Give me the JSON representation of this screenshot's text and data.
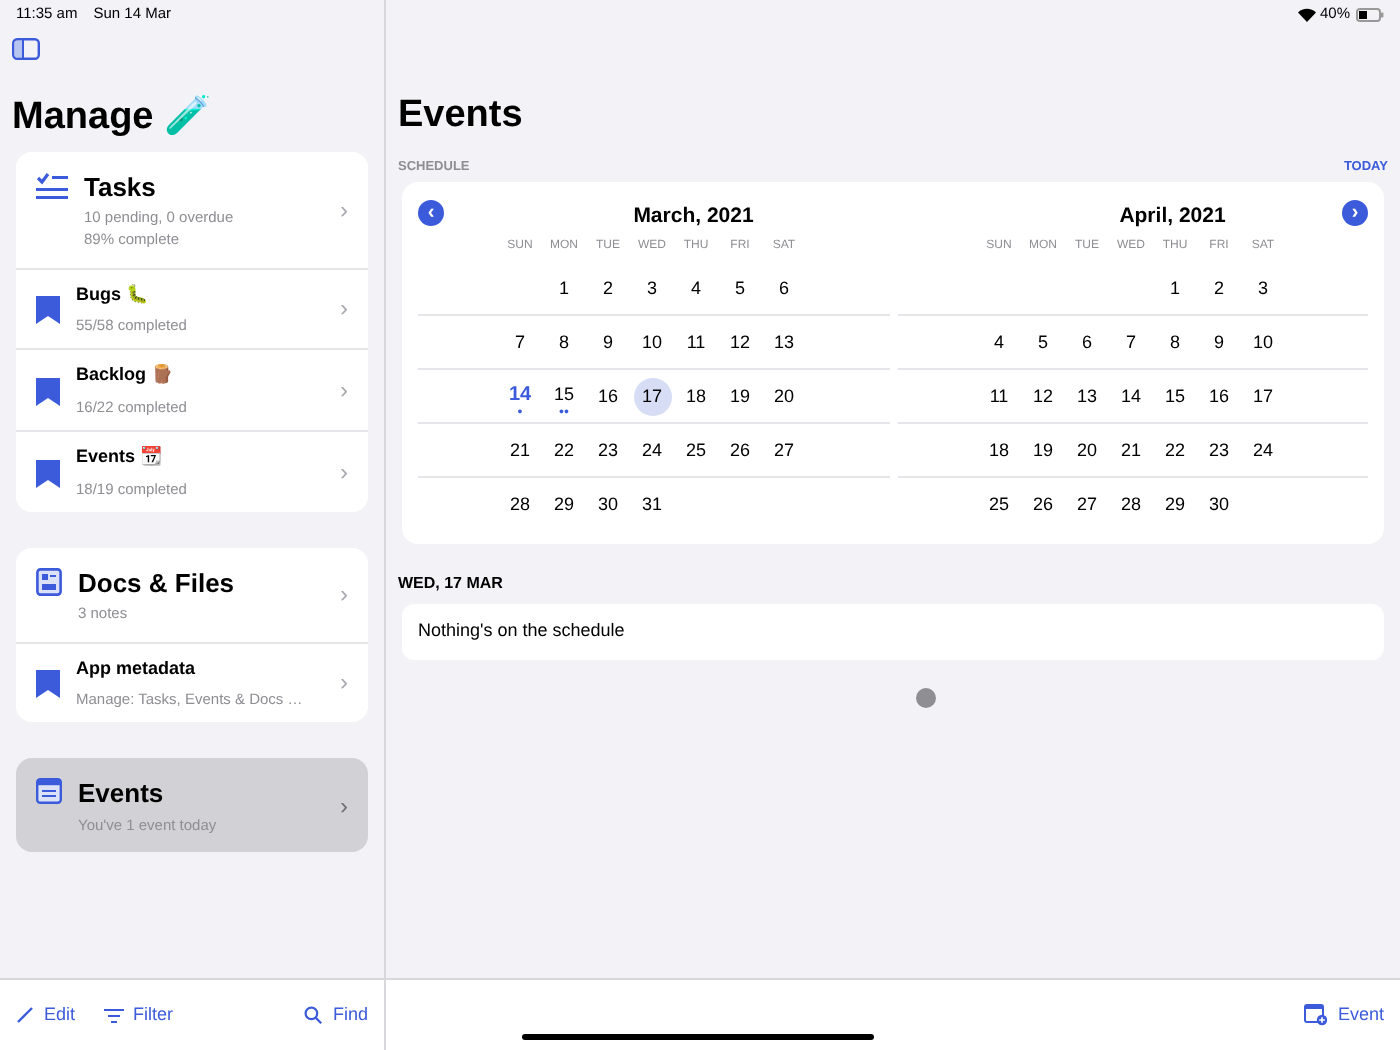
{
  "status_bar": {
    "time": "11:35 am",
    "date": "Sun 14 Mar",
    "battery": "40%"
  },
  "sidebar": {
    "title": "Manage 🧪",
    "groups": [
      {
        "items": [
          {
            "kind": "header",
            "title": "Tasks",
            "lines": [
              "10 pending, 0 overdue",
              "89% complete"
            ],
            "selected": false
          },
          {
            "kind": "list",
            "title": "Bugs 🐛",
            "lines": [
              "55/58 completed"
            ],
            "selected": false
          },
          {
            "kind": "list",
            "title": "Backlog 🪵",
            "lines": [
              "16/22 completed"
            ],
            "selected": false
          },
          {
            "kind": "list",
            "title": "Events 📆",
            "lines": [
              "18/19 completed"
            ],
            "selected": false
          }
        ]
      },
      {
        "items": [
          {
            "kind": "header",
            "title": "Docs & Files",
            "lines": [
              "3 notes"
            ],
            "selected": false
          },
          {
            "kind": "list",
            "title": "App metadata",
            "lines": [
              "Manage: Tasks, Events & Docs …"
            ],
            "selected": false
          }
        ]
      },
      {
        "items": [
          {
            "kind": "header",
            "title": "Events",
            "lines": [
              "You've 1 event today"
            ],
            "selected": true
          }
        ]
      }
    ],
    "chevron": "›",
    "toolbar": [
      {
        "label": "Edit"
      },
      {
        "label": "Filter"
      },
      {
        "label": "Find"
      }
    ]
  },
  "main": {
    "title": "Events",
    "section_label": "SCHEDULE",
    "today_link": "TODAY",
    "calendar": {
      "prev": "‹",
      "next": "›",
      "months": [
        {
          "title": "March, 2021",
          "weekdays": [
            "SUN",
            "MON",
            "TUE",
            "WED",
            "THU",
            "FRI",
            "SAT"
          ],
          "weeks": [
            {
              "kind": "leading",
              "days": [
                {
                  "n": "1",
                  "selected": false
                },
                {
                  "n": "2",
                  "selected": false
                },
                {
                  "n": "3",
                  "selected": false
                },
                {
                  "n": "4",
                  "selected": false
                },
                {
                  "n": "5",
                  "selected": false
                },
                {
                  "n": "6",
                  "selected": false
                }
              ]
            },
            {
              "kind": "full",
              "days": [
                {
                  "n": "7",
                  "selected": false
                },
                {
                  "n": "8",
                  "selected": false
                },
                {
                  "n": "9",
                  "selected": false
                },
                {
                  "n": "10",
                  "selected": false
                },
                {
                  "n": "11",
                  "selected": false
                },
                {
                  "n": "12",
                  "selected": false
                },
                {
                  "n": "13",
                  "selected": false
                }
              ]
            },
            {
              "kind": "full",
              "days": [
                {
                  "n": "14",
                  "selected": false,
                  "today": true,
                  "dots": "•"
                },
                {
                  "n": "15",
                  "selected": false,
                  "dots": "••"
                },
                {
                  "n": "16",
                  "selected": false
                },
                {
                  "n": "17",
                  "selected": true
                },
                {
                  "n": "18",
                  "selected": false
                },
                {
                  "n": "19",
                  "selected": false
                },
                {
                  "n": "20",
                  "selected": false
                }
              ]
            },
            {
              "kind": "full",
              "days": [
                {
                  "n": "21",
                  "selected": false
                },
                {
                  "n": "22",
                  "selected": false
                },
                {
                  "n": "23",
                  "selected": false
                },
                {
                  "n": "24",
                  "selected": false
                },
                {
                  "n": "25",
                  "selected": false
                },
                {
                  "n": "26",
                  "selected": false
                },
                {
                  "n": "27",
                  "selected": false
                }
              ]
            },
            {
              "kind": "trailing",
              "days": [
                {
                  "n": "28",
                  "selected": false
                },
                {
                  "n": "29",
                  "selected": false
                },
                {
                  "n": "30",
                  "selected": false
                },
                {
                  "n": "31",
                  "selected": false
                }
              ]
            }
          ]
        },
        {
          "title": "April, 2021",
          "weekdays": [
            "SUN",
            "MON",
            "TUE",
            "WED",
            "THU",
            "FRI",
            "SAT"
          ],
          "weeks": [
            {
              "kind": "leading",
              "days": [
                {
                  "n": "1",
                  "selected": false
                },
                {
                  "n": "2",
                  "selected": false
                },
                {
                  "n": "3",
                  "selected": false
                }
              ]
            },
            {
              "kind": "full",
              "days": [
                {
                  "n": "4",
                  "selected": false
                },
                {
                  "n": "5",
                  "selected": false
                },
                {
                  "n": "6",
                  "selected": false
                },
                {
                  "n": "7",
                  "selected": false
                },
                {
                  "n": "8",
                  "selected": false
                },
                {
                  "n": "9",
                  "selected": false
                },
                {
                  "n": "10",
                  "selected": false
                }
              ]
            },
            {
              "kind": "full",
              "days": [
                {
                  "n": "11",
                  "selected": false
                },
                {
                  "n": "12",
                  "selected": false
                },
                {
                  "n": "13",
                  "selected": false
                },
                {
                  "n": "14",
                  "selected": false
                },
                {
                  "n": "15",
                  "selected": false
                },
                {
                  "n": "16",
                  "selected": false
                },
                {
                  "n": "17",
                  "selected": false
                }
              ]
            },
            {
              "kind": "full",
              "days": [
                {
                  "n": "18",
                  "selected": false
                },
                {
                  "n": "19",
                  "selected": false
                },
                {
                  "n": "20",
                  "selected": false
                },
                {
                  "n": "21",
                  "selected": false
                },
                {
                  "n": "22",
                  "selected": false
                },
                {
                  "n": "23",
                  "selected": false
                },
                {
                  "n": "24",
                  "selected": false
                }
              ]
            },
            {
              "kind": "trailing",
              "days": [
                {
                  "n": "25",
                  "selected": false
                },
                {
                  "n": "26",
                  "selected": false
                },
                {
                  "n": "27",
                  "selected": false
                },
                {
                  "n": "28",
                  "selected": false
                },
                {
                  "n": "29",
                  "selected": false
                },
                {
                  "n": "30",
                  "selected": false
                }
              ]
            }
          ]
        }
      ]
    },
    "day_label": "WED, 17 MAR",
    "day_message": "Nothing's on the schedule",
    "toolbar": [
      {
        "label": "Event"
      }
    ]
  }
}
